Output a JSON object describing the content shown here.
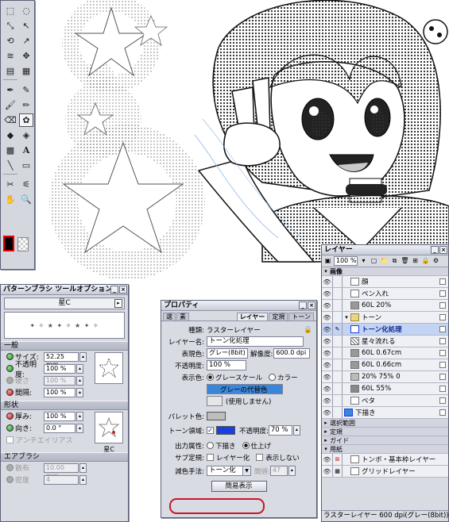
{
  "toolbox": {
    "title": "",
    "tools": [
      "marquee-rect",
      "lasso",
      "move-layer",
      "object-select",
      "rotate",
      "transform",
      "hand-pan",
      "move-cross",
      "ruler",
      "grid-select",
      "pen",
      "pencil",
      "brush",
      "airbrush",
      "eraser",
      "pattern-brush",
      "fill",
      "tone-fill",
      "gradient",
      "text",
      "line",
      "rectangle",
      "eyedropper",
      "magic-wand",
      "hand",
      "zoom"
    ]
  },
  "brush_options": {
    "title": "パターンブラシ ツールオプション",
    "brush_name": "星C",
    "sections": {
      "general": "一般",
      "shape": "形状",
      "airbrush": "エアブラシ"
    },
    "general": [
      {
        "label": "サイズ:",
        "value": "52.25 mm",
        "state": "on"
      },
      {
        "label": "不透明度:",
        "value": "100 %",
        "state": "on"
      },
      {
        "label": "硬さ",
        "value": "100 %",
        "state": "disabled"
      },
      {
        "label": "間隔:",
        "value": "100 %",
        "state": "red"
      }
    ],
    "general_thumb_label": "",
    "shape": [
      {
        "label": "厚み:",
        "value": "100 %",
        "state": "red"
      },
      {
        "label": "向き:",
        "value": "0.0 °",
        "state": "on"
      }
    ],
    "antialias": "アンチエイリアス",
    "shape_thumb_label": "星C",
    "airbrush": [
      {
        "label": "散布",
        "value": "10.00 mm"
      },
      {
        "label": "密度",
        "value": "4"
      }
    ]
  },
  "properties": {
    "title": "プロパティ",
    "tabs": [
      "選",
      "素",
      "レイヤー",
      "定規",
      "トーン"
    ],
    "active_tab": "レイヤー",
    "kind_label": "種類:",
    "kind_value": "ラスターレイヤー",
    "name_label": "レイヤー名:",
    "name_value": "トーン化処理",
    "display_label": "表現色:",
    "display_value": "グレー(8bit)",
    "resolution_label": "解像度:",
    "resolution_value": "600.0 dpi",
    "opacity_label": "不透明度:",
    "opacity_value": "100 %",
    "color_label": "表示色:",
    "color_gray": "グレースケール",
    "color_color": "カラー",
    "gray_alt": "グレーの代替色",
    "unused": "(使用しません)",
    "palette_label": "パレット色:",
    "tone_area_label": "トーン領域:",
    "tone_opacity_label": "不透明度:",
    "tone_opacity_value": "70 %",
    "output_label": "出力属性:",
    "output_draft": "下描き",
    "output_final": "仕上げ",
    "sub_ruler_label": "サブ定規:",
    "sub_ruler_layer": "レイヤー化",
    "sub_ruler_hide": "表示しない",
    "reduction_label": "減色手法:",
    "reduction_value": "トーン化",
    "threshold_label": "閾値:",
    "threshold_value": "47",
    "simple_button": "簡易表示",
    "colors": {
      "accent": "#1a3fe0",
      "gray_alt": "#3a86d8",
      "highlight": "#c4182a"
    }
  },
  "layers": {
    "title": "レイヤー",
    "zoom": "100 %",
    "rows": [
      {
        "name": "画像",
        "type": "header"
      },
      {
        "name": "顔",
        "type": "layer"
      },
      {
        "name": "ペン入れ",
        "type": "layer"
      },
      {
        "name": "60L 20%",
        "type": "tone"
      },
      {
        "name": "トーン",
        "type": "folder"
      },
      {
        "name": "トーン化処理",
        "type": "selected"
      },
      {
        "name": "星々流れる",
        "type": "tone"
      },
      {
        "name": "60L 0.67cm",
        "type": "tone"
      },
      {
        "name": "60L 0.66cm",
        "type": "tone"
      },
      {
        "name": "20% 75% 0",
        "type": "tone"
      },
      {
        "name": "60L 55%",
        "type": "tone"
      },
      {
        "name": "ベタ",
        "type": "layer"
      },
      {
        "name": "下描き",
        "type": "layer"
      },
      {
        "name": "選択範囲",
        "type": "header"
      },
      {
        "name": "定規",
        "type": "header"
      },
      {
        "name": "ガイド",
        "type": "header"
      },
      {
        "name": "用紙",
        "type": "header"
      },
      {
        "name": "トンボ・基本枠レイヤー",
        "type": "layer"
      },
      {
        "name": "グリッドレイヤー",
        "type": "layer"
      }
    ],
    "status": "ラスターレイヤー 600 dpi(グレー(8bit))"
  }
}
